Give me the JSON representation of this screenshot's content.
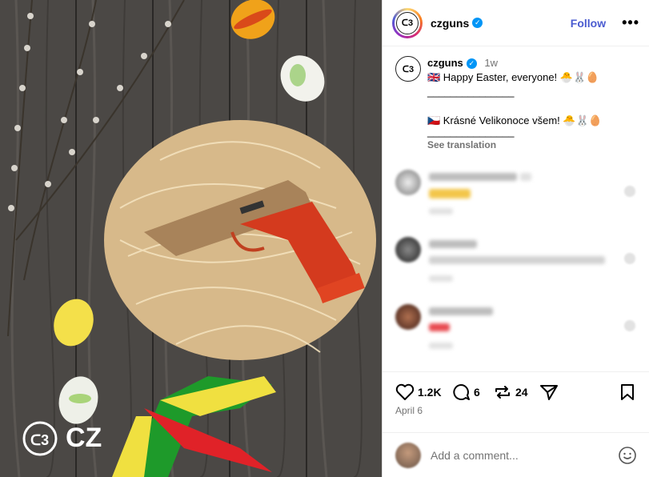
{
  "post": {
    "watermark_text": "CZ"
  },
  "header": {
    "username": "czguns",
    "follow_label": "Follow",
    "more_label": "•••"
  },
  "caption": {
    "username": "czguns",
    "time": "1w",
    "line1": "🇬🇧 Happy Easter, everyone! 🐣🐰🥚",
    "divider1": "_______________",
    "line2": "🇨🇿 Krásné Velikonoce všem! 🐣🐰🥚",
    "divider2": "_______________",
    "see_translation": "See translation"
  },
  "actions": {
    "likes": "1.2K",
    "comments": "6",
    "reposts": "24",
    "date": "April 6"
  },
  "add_comment": {
    "placeholder": "Add a comment..."
  },
  "colors": {
    "follow": "#4a5bd0",
    "verified": "#0095f6"
  }
}
